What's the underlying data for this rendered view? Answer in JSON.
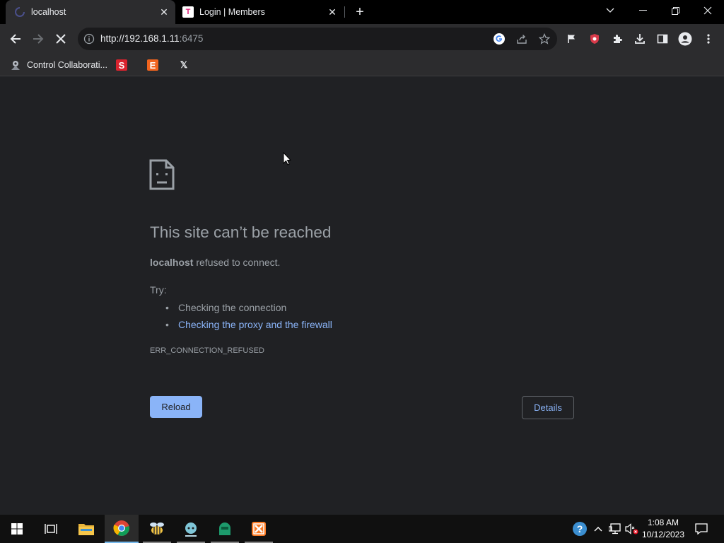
{
  "browser": {
    "tabs": [
      {
        "title": "localhost",
        "active": true
      },
      {
        "title": "Login | Members",
        "active": false,
        "favicon_letter": "T"
      }
    ],
    "address": {
      "host": "http://192.168.1.11",
      "port": ":6475"
    },
    "bookmarks": [
      {
        "label": "Control Collaborati..."
      },
      {
        "letter": "S"
      },
      {
        "letter": "E"
      },
      {
        "letter": "𝕏"
      }
    ]
  },
  "error_page": {
    "title": "This site can’t be reached",
    "host": "localhost",
    "message": "refused to connect.",
    "try_label": "Try:",
    "suggestions": [
      "Checking the connection",
      "Checking the proxy and the firewall"
    ],
    "code": "ERR_CONNECTION_REFUSED",
    "reload_label": "Reload",
    "details_label": "Details"
  },
  "taskbar": {
    "time": "1:08 AM",
    "date": "10/12/2023"
  },
  "colors": {
    "link": "#8ab4f8",
    "page_bg": "#202124",
    "text_muted": "#9aa0a6"
  }
}
